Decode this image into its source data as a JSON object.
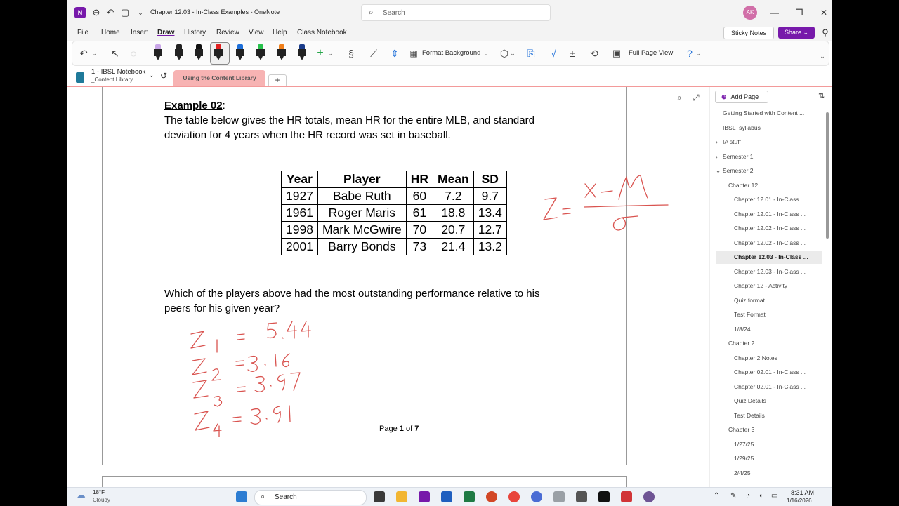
{
  "window": {
    "title": "Chapter 12.03 - In-Class Examples - OneNote",
    "search_placeholder": "Search",
    "avatar_initials": "AK"
  },
  "menu": {
    "items": [
      "File",
      "Home",
      "Insert",
      "Draw",
      "History",
      "Review",
      "View",
      "Help",
      "Class Notebook"
    ],
    "active": "Draw",
    "sticky_notes": "Sticky Notes",
    "share": "Share"
  },
  "toolbar": {
    "format_background": "Format Background",
    "full_page_view": "Full Page View",
    "pen_colors": [
      "#c9a6e8",
      "#222222",
      "#111111",
      "#e02020",
      "#1e6fd9",
      "#27c24c",
      "#f07f1a",
      "#1a3c8a"
    ]
  },
  "notebook": {
    "name": "1 - IBSL Notebook",
    "subtitle": "_Content Library",
    "section_tab": "Using the Content Library",
    "add_tab": "+"
  },
  "document": {
    "heading": "Example 02",
    "heading_suffix": ":",
    "intro_line1": "The table below gives the HR totals, mean HR for the entire MLB, and standard",
    "intro_line2": "deviation for 4 years when the HR record was set in baseball.",
    "table": {
      "headers": [
        "Year",
        "Player",
        "HR",
        "Mean",
        "SD"
      ],
      "rows": [
        [
          "1927",
          "Babe Ruth",
          "60",
          "7.2",
          "9.7"
        ],
        [
          "1961",
          "Roger Maris",
          "61",
          "18.8",
          "13.4"
        ],
        [
          "1998",
          "Mark McGwire",
          "70",
          "20.7",
          "12.7"
        ],
        [
          "2001",
          "Barry Bonds",
          "73",
          "21.4",
          "13.2"
        ]
      ]
    },
    "question_line1": "Which of the players above had the most outstanding performance relative to his",
    "question_line2": "peers for his given year?",
    "page_label": "Page",
    "page_current": "1",
    "page_of": "of",
    "page_total": "7",
    "ink": {
      "formula": "Z = (x − μ) / σ",
      "z1": "Z1 = 5.44",
      "z2": "Z2 = 3.16",
      "z3": "Z3 = 3.87",
      "z4": "Z4 = 3.91",
      "color": "#d9534f"
    }
  },
  "pages_pane": {
    "add_page": "Add Page",
    "items": [
      {
        "label": "Getting Started with Content ...",
        "indent": 0,
        "chevron": ""
      },
      {
        "label": "IBSL_syllabus",
        "indent": 0,
        "chevron": ""
      },
      {
        "label": "IA stuff",
        "indent": 0,
        "chevron": "›"
      },
      {
        "label": "Semester 1",
        "indent": 0,
        "chevron": "›"
      },
      {
        "label": "Semester 2",
        "indent": 0,
        "chevron": "⌄"
      },
      {
        "label": "Chapter 12",
        "indent": 1,
        "chevron": ""
      },
      {
        "label": "Chapter 12.01 - In-Class ...",
        "indent": 2,
        "chevron": ""
      },
      {
        "label": "Chapter 12.01 - In-Class ...",
        "indent": 2,
        "chevron": ""
      },
      {
        "label": "Chapter 12.02 - In-Class ...",
        "indent": 2,
        "chevron": ""
      },
      {
        "label": "Chapter 12.02 - In-Class ...",
        "indent": 2,
        "chevron": ""
      },
      {
        "label": "Chapter 12.03 - In-Class ...",
        "indent": 2,
        "chevron": "",
        "selected": true
      },
      {
        "label": "Chapter 12.03 - In-Class ...",
        "indent": 2,
        "chevron": ""
      },
      {
        "label": "Chapter 12 - Activity",
        "indent": 2,
        "chevron": ""
      },
      {
        "label": "Quiz format",
        "indent": 2,
        "chevron": ""
      },
      {
        "label": "Test Format",
        "indent": 2,
        "chevron": ""
      },
      {
        "label": "1/8/24",
        "indent": 2,
        "chevron": ""
      },
      {
        "label": "Chapter 2",
        "indent": 1,
        "chevron": ""
      },
      {
        "label": "Chapter 2 Notes",
        "indent": 2,
        "chevron": ""
      },
      {
        "label": "Chapter 02.01 - In-Class ...",
        "indent": 2,
        "chevron": ""
      },
      {
        "label": "Chapter 02.01 - In-Class ...",
        "indent": 2,
        "chevron": ""
      },
      {
        "label": "Quiz Details",
        "indent": 2,
        "chevron": ""
      },
      {
        "label": "Test Details",
        "indent": 2,
        "chevron": ""
      },
      {
        "label": "Chapter 3",
        "indent": 1,
        "chevron": ""
      },
      {
        "label": "1/27/25",
        "indent": 2,
        "chevron": ""
      },
      {
        "label": "1/29/25",
        "indent": 2,
        "chevron": ""
      },
      {
        "label": "2/4/25",
        "indent": 2,
        "chevron": ""
      }
    ]
  },
  "taskbar": {
    "weather_temp": "18°F",
    "weather_desc": "Cloudy",
    "search_label": "Search",
    "time": "8:31 AM",
    "date": "1/16/2026"
  }
}
